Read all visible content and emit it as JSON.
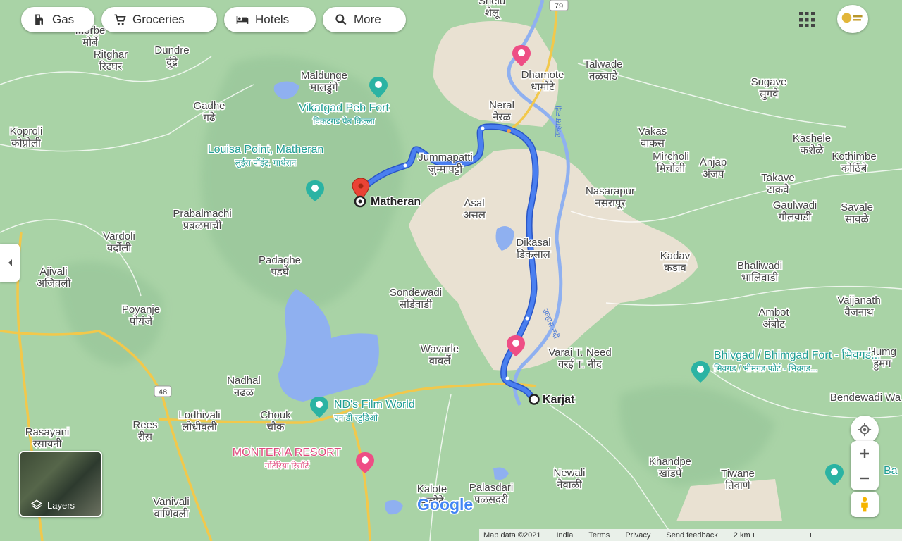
{
  "top_chips": [
    {
      "label": "Gas",
      "icon": "gas-station-icon"
    },
    {
      "label": "Groceries",
      "icon": "shopping-cart-icon"
    },
    {
      "label": "Hotels",
      "icon": "hotel-bed-icon"
    },
    {
      "label": "More",
      "icon": "search-icon"
    }
  ],
  "route": {
    "origin": "Matheran",
    "destination": "Karjat"
  },
  "places": [
    {
      "en": "Morbe",
      "mr": "मोर्बे"
    },
    {
      "en": "Ritghar",
      "mr": "रिटघर"
    },
    {
      "en": "Dundre",
      "mr": "दुंद्रे"
    },
    {
      "en": "Maldunge",
      "mr": "मालडुंगे"
    },
    {
      "en": "Gadhe",
      "mr": "गढे"
    },
    {
      "en": "Koproli",
      "mr": "कोप्रोली"
    },
    {
      "en": "Prabalmachi",
      "mr": "प्रबळमाची"
    },
    {
      "en": "Vardoli",
      "mr": "वर्दोली"
    },
    {
      "en": "Ajivali",
      "mr": "अजिवली"
    },
    {
      "en": "Padaghe",
      "mr": "पडघे"
    },
    {
      "en": "Poyanje",
      "mr": "पोयंजे"
    },
    {
      "en": "Sondewadi",
      "mr": "सोंडेवाडी"
    },
    {
      "en": "Wavarle",
      "mr": "वावर्ले"
    },
    {
      "en": "Nadhal",
      "mr": "नढळ"
    },
    {
      "en": "Lodhivali",
      "mr": "लोधीवली"
    },
    {
      "en": "Chouk",
      "mr": "चौक"
    },
    {
      "en": "Rees",
      "mr": "रीस"
    },
    {
      "en": "Rasayani",
      "mr": "रसायनी"
    },
    {
      "en": "Vanivali",
      "mr": "वाणिवली"
    },
    {
      "en": "Kalote",
      "mr": "कलोटे"
    },
    {
      "en": "Palasdari",
      "mr": "पळसदरी"
    },
    {
      "en": "Newali",
      "mr": "नेवाळी"
    },
    {
      "en": "Khandpe",
      "mr": "खांडपे"
    },
    {
      "en": "Tiwane",
      "mr": "तिवाणे"
    },
    {
      "en": "Varai T. Need",
      "mr": "वरई T. नीद"
    },
    {
      "en": "Dikasal",
      "mr": "डिकसाल"
    },
    {
      "en": "Asal",
      "mr": "असल"
    },
    {
      "en": "Jummapatti",
      "mr": "जुम्मापट्टी"
    },
    {
      "en": "Neral",
      "mr": "नेरळ"
    },
    {
      "en": "Dhamote",
      "mr": "धामोटे"
    },
    {
      "en": "Talwade",
      "mr": "तळवाडे"
    },
    {
      "en": "Sugave",
      "mr": "सुगवे"
    },
    {
      "en": "Kashele",
      "mr": "कशेळे"
    },
    {
      "en": "Kothimbe",
      "mr": "कोठिंबे"
    },
    {
      "en": "Vakas",
      "mr": "वाकस"
    },
    {
      "en": "Mircholi",
      "mr": "मिर्चोली"
    },
    {
      "en": "Anjap",
      "mr": "अंजप"
    },
    {
      "en": "Nasarapur",
      "mr": "नसरापूर"
    },
    {
      "en": "Takave",
      "mr": "टाकवे"
    },
    {
      "en": "Gaulwadi",
      "mr": "गौलवाडी"
    },
    {
      "en": "Savale",
      "mr": "सावळे"
    },
    {
      "en": "Kadav",
      "mr": "कडाव"
    },
    {
      "en": "Bhaliwadi",
      "mr": "भालिवाडी"
    },
    {
      "en": "Ambot",
      "mr": "अंबोट"
    },
    {
      "en": "Vaijanath",
      "mr": "वैजनाथ"
    },
    {
      "en": "Humg",
      "mr": "हुमग"
    },
    {
      "en": "Bendewadi Wa",
      "mr": ""
    },
    {
      "en": "Shelu",
      "mr": "शेलू"
    }
  ],
  "pois": [
    {
      "en": "Vikatgad Peb Fort",
      "mr": "विकटगड पेब किल्ला"
    },
    {
      "en": "Louisa Point, Matheran",
      "mr": "लुईस पॉइंट, माथेरान"
    },
    {
      "en": "ND's Film World",
      "mr": "एन डी स्टुडिओ"
    },
    {
      "en": "MONTERIA RESORT",
      "mr": "मोंटेरिया रिसॉर्ट"
    },
    {
      "en": "Bhivgad / Bhimgad Fort - भिवगड...",
      "mr": "भिवगड / भीमगड फोर्ट - भिवगड..."
    },
    {
      "en": "Ba",
      "mr": ""
    }
  ],
  "road_shields": {
    "r79": "79",
    "r48": "48"
  },
  "river_label": "उल्हास नदी",
  "logo": "Google",
  "layers_label": "Layers",
  "attribution": {
    "map_data": "Map data ©2021",
    "region": "India",
    "terms": "Terms",
    "privacy": "Privacy",
    "feedback": "Send feedback",
    "scale": "2 km"
  },
  "colors": {
    "route": "#4a7ff0",
    "route_outline": "#2a56c6",
    "water": "#8fb0f0",
    "urban": "#ece4d6",
    "land": "#a9d3a6",
    "highway": "#f2c84b",
    "destination_pin": "#ea4335",
    "poi_pink": "#ee4e85",
    "poi_teal": "#2bb3a3"
  }
}
